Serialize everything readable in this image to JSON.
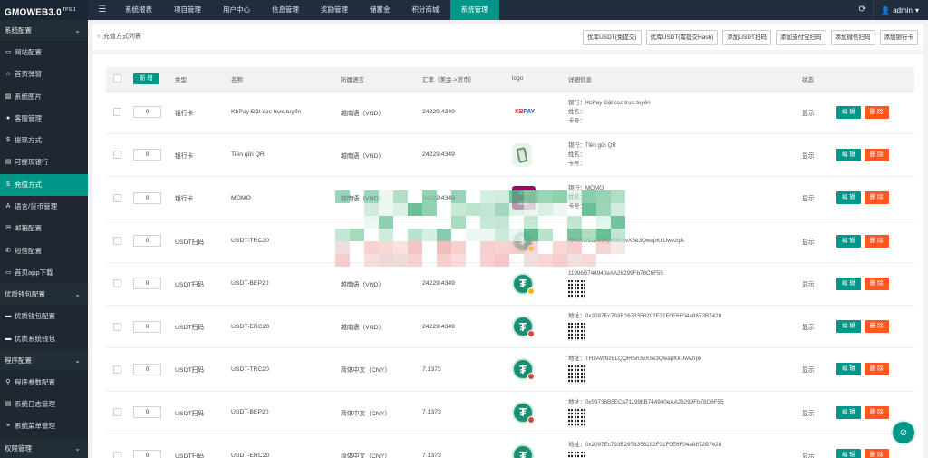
{
  "app": {
    "logo": "GMOWEB3.0",
    "logo_sup": "TPS.1"
  },
  "topnav": [
    {
      "label": "系统报表"
    },
    {
      "label": "项目管理"
    },
    {
      "label": "用户中心"
    },
    {
      "label": "信息管理"
    },
    {
      "label": "奖励管理"
    },
    {
      "label": "储蓄金"
    },
    {
      "label": "积分商城"
    },
    {
      "label": "系统管理",
      "active": true
    }
  ],
  "user": {
    "name": "admin"
  },
  "sidebar": [
    {
      "kind": "group",
      "label": "系统配置"
    },
    {
      "kind": "item",
      "label": "网站配置",
      "icon": "monitor-icon"
    },
    {
      "kind": "item",
      "label": "首页弹窗",
      "icon": "home-icon"
    },
    {
      "kind": "item",
      "label": "系统图片",
      "icon": "image-icon"
    },
    {
      "kind": "item",
      "label": "客服管理",
      "icon": "chat-icon"
    },
    {
      "kind": "item",
      "label": "提现方式",
      "icon": "dollar-icon"
    },
    {
      "kind": "item",
      "label": "可提现银行",
      "icon": "bank-icon"
    },
    {
      "kind": "item",
      "label": "充值方式",
      "icon": "dollar-icon",
      "active": true
    },
    {
      "kind": "item",
      "label": "语言/货币管理",
      "icon": "font-icon"
    },
    {
      "kind": "item",
      "label": "邮箱配置",
      "icon": "mail-icon"
    },
    {
      "kind": "item",
      "label": "短信配置",
      "icon": "sms-icon"
    },
    {
      "kind": "item",
      "label": "首页app下载",
      "icon": "download-icon"
    },
    {
      "kind": "group",
      "label": "优质钱包配置"
    },
    {
      "kind": "item",
      "label": "优质钱包配置",
      "icon": "wallet-icon"
    },
    {
      "kind": "item",
      "label": "优质系统钱包",
      "icon": "wallet-icon"
    },
    {
      "kind": "group",
      "label": "程序配置"
    },
    {
      "kind": "item",
      "label": "程序参数配置",
      "icon": "link-icon"
    },
    {
      "kind": "item",
      "label": "系统日志管理",
      "icon": "log-icon"
    },
    {
      "kind": "item",
      "label": "系统菜单管理",
      "icon": "menu-icon"
    },
    {
      "kind": "group",
      "label": "权限管理"
    }
  ],
  "breadcrumb": "充值方式列表",
  "toolbar": [
    "优库USDT(免提交)",
    "优库USDT(需提交Hash)",
    "添加USDT扫码",
    "添加支付宝扫码",
    "添加微信扫码",
    "添加银行卡"
  ],
  "table": {
    "new_label": "新 增",
    "headers": [
      "类型",
      "名称",
      "所属语言",
      "汇率（美金->货币）",
      "logo",
      "详细信息",
      "状态",
      ""
    ],
    "edit_label": "编 辑",
    "delete_label": "删 除",
    "rows": [
      {
        "sort": "0",
        "type": "银行卡",
        "name": "KbPay Đặt cọc trực tuyến",
        "lang": "越南语（VND）",
        "rate": "24229.4349",
        "logo": "kbpay",
        "detail": [
          "银行：KbPay Đặt cọc trực tuyến",
          "姓名：",
          "卡号："
        ],
        "qr": false,
        "status": "显示"
      },
      {
        "sort": "0",
        "type": "银行卡",
        "name": "Tiền gửi QR",
        "lang": "越南语（VND）",
        "rate": "24229.4349",
        "logo": "qrphone",
        "detail": [
          "银行：Tiền gửi QR",
          "姓名：",
          "卡号："
        ],
        "qr": false,
        "status": "显示"
      },
      {
        "sort": "0",
        "type": "银行卡",
        "name": "MOMO",
        "lang": "越南语（VND）",
        "rate": "24229.4349",
        "logo": "momo",
        "detail": [
          "银行：MOMO",
          "姓名：",
          "卡号："
        ],
        "qr": false,
        "status": "显示"
      },
      {
        "sort": "0",
        "type": "USDT扫码",
        "name": "USDT-TRC20",
        "lang": "",
        "rate": "",
        "logo": "tether",
        "detail": [
          "TH3AWbzELQQiRSh3vX5e3QwapKkUwvzipk"
        ],
        "qr": false,
        "status": "显示"
      },
      {
        "sort": "0",
        "type": "USDT扫码",
        "name": "USDT-BEP20",
        "lang": "越南语（VND）",
        "rate": "24229.4349",
        "logo": "tether",
        "detail": [
          "1199bB744940eAA26299Fb78C6F55"
        ],
        "qr": true,
        "status": "显示"
      },
      {
        "sort": "0",
        "type": "USDT扫码",
        "name": "USDT-ERC20",
        "lang": "越南语（VND）",
        "rate": "24229.4349",
        "logo": "tether",
        "detail": [
          "地址：0x2097Ec793E2678358292F31F0E6F04a8872B7428"
        ],
        "qr": true,
        "status": "显示"
      },
      {
        "sort": "0",
        "type": "USDT扫码",
        "name": "USDT-TRC20",
        "lang": "简体中文（CNY）",
        "rate": "7.1373",
        "logo": "tether",
        "detail": [
          "地址：TH3AWbzELQQiRSh3vX5e3QwapKkUwvzipk"
        ],
        "qr": true,
        "status": "显示"
      },
      {
        "sort": "0",
        "type": "USDT扫码",
        "name": "USDT-BEP20",
        "lang": "简体中文（CNY）",
        "rate": "7.1373",
        "logo": "tether",
        "detail": [
          "地址：0x59736B5ECa71199bB744940eAA26299Fb78C6F55"
        ],
        "qr": true,
        "status": "显示"
      },
      {
        "sort": "0",
        "type": "USDT扫码",
        "name": "USDT-ERC20",
        "lang": "简体中文（CNY）",
        "rate": "7.1373",
        "logo": "tether",
        "detail": [
          "地址：0x2097Ec793E2678358292F31F0E6F04a8872B7428"
        ],
        "qr": true,
        "status": "显示"
      }
    ]
  },
  "colors": {
    "accent": "#009688",
    "danger": "#ff5722",
    "sidebar": "#28333e",
    "topbar": "#1f2d3d",
    "success_text": "#13a34a"
  }
}
